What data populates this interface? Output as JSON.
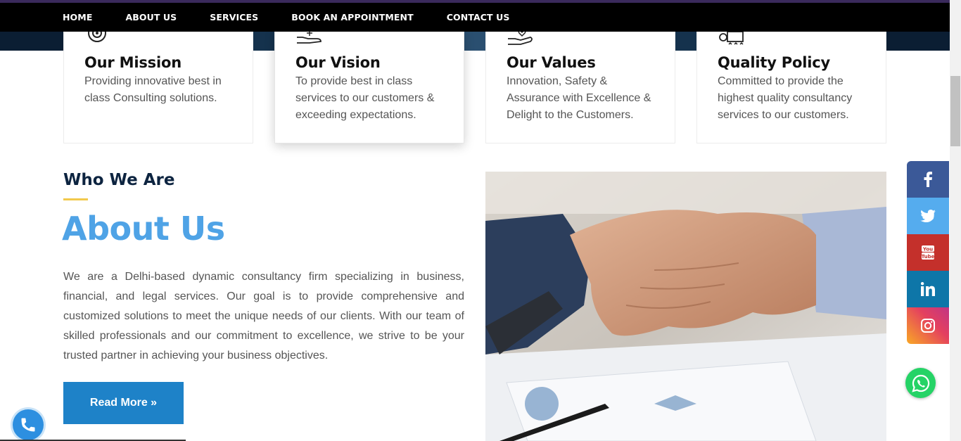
{
  "nav": {
    "items": [
      "HOME",
      "ABOUT US",
      "SERVICES",
      "BOOK AN APPOINTMENT",
      "CONTACT US"
    ]
  },
  "cards": [
    {
      "icon": "target-icon",
      "title": "Our Mission",
      "text": "Providing innovative best in class Consulting solutions."
    },
    {
      "icon": "hand-bulb-icon",
      "title": "Our Vision",
      "text": "To provide best in class services to our customers & exceeding expectations."
    },
    {
      "icon": "hand-heart-icon",
      "title": "Our Values",
      "text": "Innovation, Safety & Assurance with Excellence & Delight to the Customers."
    },
    {
      "icon": "certificate-icon",
      "title": "Quality Policy",
      "text": "Committed to provide the highest quality consultancy services to our customers."
    }
  ],
  "about": {
    "kicker": "Who We Are",
    "title": "About Us",
    "text": "We are a Delhi-based dynamic consultancy firm specializing in business, financial, and legal services. Our goal is to provide comprehensive and customized solutions to meet the unique needs of our clients. With our team of skilled professionals and our commitment to excellence, we strive to be your trusted partner in achieving your business objectives.",
    "button": "Read More »"
  },
  "social": [
    {
      "icon": "facebook-icon",
      "color": "#3b5998"
    },
    {
      "icon": "twitter-icon",
      "color": "#55acee"
    },
    {
      "icon": "youtube-icon",
      "color": "#c4302b"
    },
    {
      "icon": "linkedin-icon",
      "color": "#0e76a8"
    },
    {
      "icon": "instagram-icon",
      "color": "#e1306c"
    }
  ],
  "colors": {
    "accent": "#4fa3e6",
    "button": "#1e82c8",
    "heading": "#0d2440",
    "underline": "#f2c94c"
  }
}
